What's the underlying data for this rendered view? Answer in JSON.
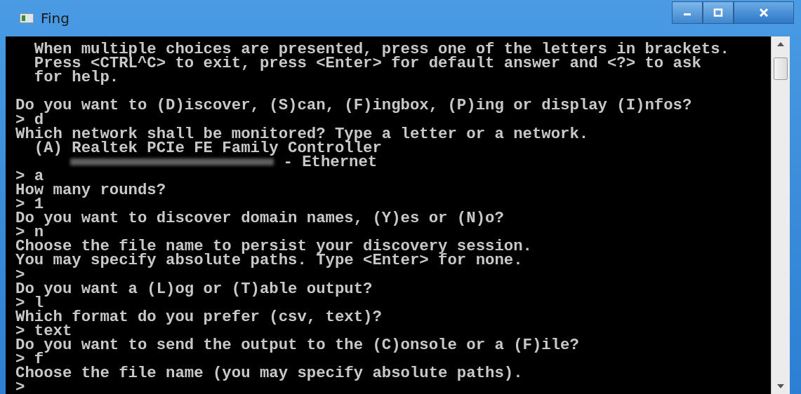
{
  "window": {
    "title": "Fing"
  },
  "console": {
    "lines": [
      {
        "kind": "text",
        "text": "  When multiple choices are presented, press one of the letters in brackets."
      },
      {
        "kind": "text",
        "text": "  Press <CTRL^C> to exit, press <Enter> for default answer and <?> to ask"
      },
      {
        "kind": "text",
        "text": "  for help."
      },
      {
        "kind": "blank"
      },
      {
        "kind": "text",
        "text": "Do you want to (D)iscover, (S)can, (F)ingbox, (P)ing or display (I)nfos?"
      },
      {
        "kind": "text",
        "text": "> d"
      },
      {
        "kind": "text",
        "text": "Which network shall be monitored? Type a letter or a network."
      },
      {
        "kind": "text",
        "text": "  (A) Realtek PCIe FE Family Controller"
      },
      {
        "kind": "redacted",
        "text": " - Ethernet"
      },
      {
        "kind": "text",
        "text": "> a"
      },
      {
        "kind": "text",
        "text": "How many rounds?"
      },
      {
        "kind": "text",
        "text": "> 1"
      },
      {
        "kind": "text",
        "text": "Do you want to discover domain names, (Y)es or (N)o?"
      },
      {
        "kind": "text",
        "text": "> n"
      },
      {
        "kind": "text",
        "text": "Choose the file name to persist your discovery session."
      },
      {
        "kind": "text",
        "text": "You may specify absolute paths. Type <Enter> for none."
      },
      {
        "kind": "text",
        "text": ">"
      },
      {
        "kind": "text",
        "text": "Do you want a (L)og or (T)able output?"
      },
      {
        "kind": "text",
        "text": "> l"
      },
      {
        "kind": "text",
        "text": "Which format do you prefer (csv, text)?"
      },
      {
        "kind": "text",
        "text": "> text"
      },
      {
        "kind": "text",
        "text": "Do you want to send the output to the (C)onsole or a (F)ile?"
      },
      {
        "kind": "text",
        "text": "> f"
      },
      {
        "kind": "text",
        "text": "Choose the file name (you may specify absolute paths)."
      },
      {
        "kind": "text",
        "text": ">"
      }
    ]
  }
}
